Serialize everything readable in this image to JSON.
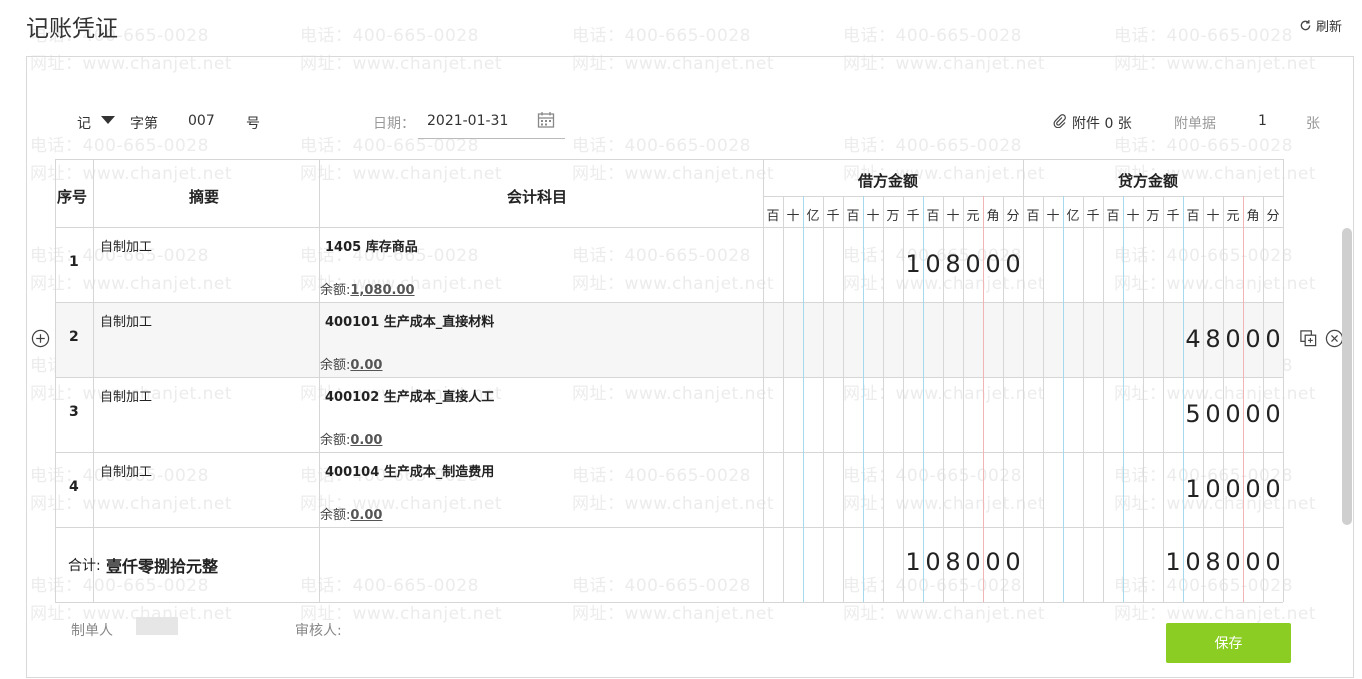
{
  "page": {
    "title": "记账凭证",
    "refresh_label": "刷新"
  },
  "watermark": {
    "phone": "电话：400-665-0028",
    "site": "网址：www.chanjet.net"
  },
  "header": {
    "voucher_word": "记",
    "zi_label": "字第",
    "number": "007",
    "hao_label": "号",
    "date_label": "日期：",
    "date_value": "2021-01-31",
    "attachment_label": "附件 0 张",
    "attach_doc_label": "附单据",
    "attach_doc_count": "1",
    "zhang_label": "张"
  },
  "table": {
    "col_seq": "序号",
    "col_summary": "摘要",
    "col_account": "会计科目",
    "col_debit": "借方金额",
    "col_credit": "贷方金额",
    "digit_headers": [
      "百",
      "十",
      "亿",
      "千",
      "百",
      "十",
      "万",
      "千",
      "百",
      "十",
      "元",
      "角",
      "分"
    ],
    "balance_label": "余额:",
    "rows": [
      {
        "no": "1",
        "summary": "自制加工",
        "account": "1405 库存商品",
        "balance": "1,080.00",
        "debit": "108000",
        "credit": ""
      },
      {
        "no": "2",
        "summary": "自制加工",
        "account": "400101 生产成本_直接材料",
        "balance": "0.00",
        "debit": "",
        "credit": "48000"
      },
      {
        "no": "3",
        "summary": "自制加工",
        "account": "400102 生产成本_直接人工",
        "balance": "0.00",
        "debit": "",
        "credit": "50000"
      },
      {
        "no": "4",
        "summary": "自制加工",
        "account": "400104 生产成本_制造费用",
        "balance": "0.00",
        "debit": "",
        "credit": "10000"
      }
    ],
    "total_label": "合计:",
    "total_words": "壹仟零捌拾元整",
    "total_debit": "108000",
    "total_credit": "108000"
  },
  "footer": {
    "maker_label": "制单人",
    "reviewer_label": "审核人:",
    "save_label": "保存"
  },
  "colors": {
    "accent": "#8bcd22",
    "grid": "#d6d6d6",
    "unit_line": "#a8d8ee",
    "yuan_line": "#f2b5b5"
  }
}
